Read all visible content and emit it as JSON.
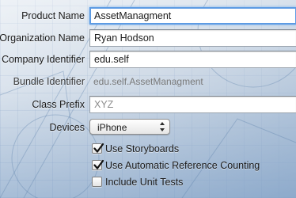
{
  "form": {
    "product_name": {
      "label": "Product Name",
      "value": "AssetManagment"
    },
    "organization_name": {
      "label": "Organization Name",
      "value": "Ryan Hodson"
    },
    "company_identifier": {
      "label": "Company Identifier",
      "value": "edu.self"
    },
    "bundle_identifier": {
      "label": "Bundle Identifier",
      "value": "edu.self.AssetManagment"
    },
    "class_prefix": {
      "label": "Class Prefix",
      "placeholder": "XYZ"
    },
    "devices": {
      "label": "Devices",
      "selected": "iPhone"
    },
    "options": [
      {
        "label": "Use Storyboards",
        "checked": true
      },
      {
        "label": "Use Automatic Reference Counting",
        "checked": true
      },
      {
        "label": "Include Unit Tests",
        "checked": false
      }
    ]
  }
}
